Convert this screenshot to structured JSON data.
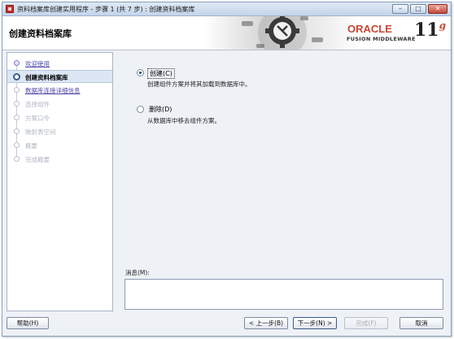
{
  "window": {
    "title": "资料档案库创建实用程序 - 步骤 1 (共 7 步) : 创建资料档案库",
    "controls": {
      "minimize": "–",
      "maximize": "□",
      "close": "✕"
    }
  },
  "banner": {
    "page_title": "创建资料档案库",
    "brand": "ORACLE",
    "product": "FUSION MIDDLEWARE",
    "version": "11",
    "version_suffix": "g"
  },
  "nav": {
    "items": [
      {
        "label": "欢迎使用",
        "state": "done"
      },
      {
        "label": "创建资料档案库",
        "state": "current"
      },
      {
        "label": "数据库连接详细信息",
        "state": "link"
      },
      {
        "label": "选择组件",
        "state": "pending"
      },
      {
        "label": "方案口令",
        "state": "pending"
      },
      {
        "label": "映射表空间",
        "state": "pending"
      },
      {
        "label": "概要",
        "state": "pending"
      },
      {
        "label": "完成概要",
        "state": "pending"
      }
    ]
  },
  "main": {
    "options": [
      {
        "label": "创建(C)",
        "description": "创建组件方案并将其加载到数据库中。",
        "checked": true
      },
      {
        "label": "删除(D)",
        "description": "从数据库中移去组件方案。",
        "checked": false
      }
    ],
    "message_label": "消息(M):",
    "message_value": ""
  },
  "footer": {
    "help": "帮助(H)",
    "back": "< 上一步(B)",
    "next": "下一步(N) >",
    "finish": "完成(F)",
    "cancel": "取消"
  },
  "colors": {
    "titlebar": "#c3d4ea",
    "nav_current": "#dce6f4",
    "link": "#4d4aa8",
    "oracle_red": "#c74634"
  }
}
